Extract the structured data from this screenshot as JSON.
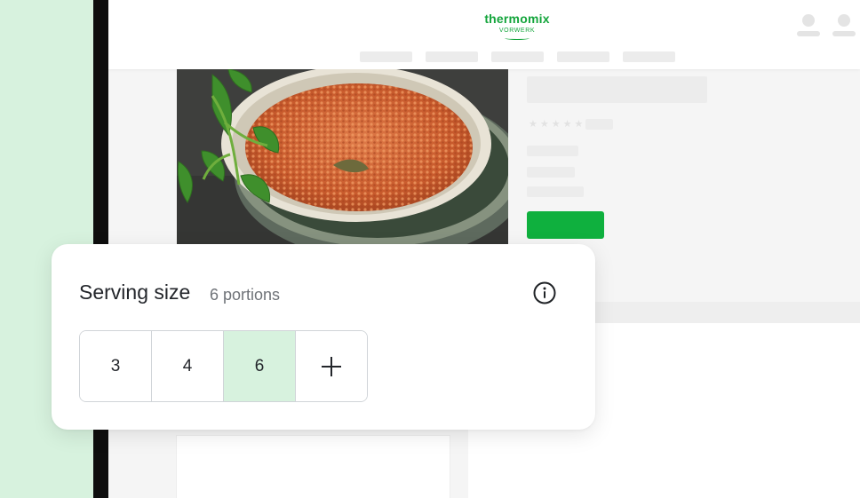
{
  "brand": {
    "name": "thermomix",
    "sub": "VORWERK",
    "color": "#14a53c"
  },
  "colors": {
    "accent_green": "#0fb03e",
    "mint": "#d7f2de",
    "text": "#23262b",
    "muted": "#6f7378"
  },
  "recipe_image": {
    "subject": "lentil bolognese in ceramic bowl with parsley"
  },
  "rating": {
    "stars": 5,
    "icon": "star-icon"
  },
  "serving_card": {
    "title": "Serving size",
    "subtitle": "6 portions",
    "info_icon": "info-icon",
    "options": [
      {
        "label": "3",
        "selected": false
      },
      {
        "label": "4",
        "selected": false
      },
      {
        "label": "6",
        "selected": true
      },
      {
        "label": "+",
        "icon": "plus-icon",
        "selected": false
      }
    ]
  }
}
